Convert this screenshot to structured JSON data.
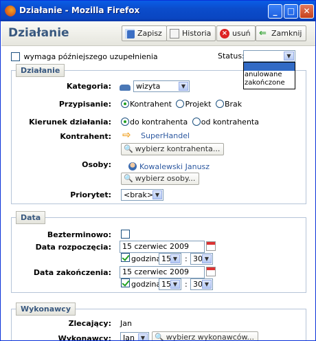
{
  "window": {
    "title": "Działanie - Mozilla Firefox",
    "min_label": "_",
    "max_label": "□",
    "close_label": "✕"
  },
  "header": {
    "page_title": "Działanie",
    "save_label": "Zapisz",
    "history_label": "Historia",
    "delete_label": "usuń",
    "close_label": "Zamknij"
  },
  "top": {
    "requires_completion_label": "wymaga późniejszego uzupełnienia",
    "status_label": "Status:",
    "status_value": "",
    "status_options": [
      "",
      "anulowane",
      "zakończone"
    ]
  },
  "dzialanie": {
    "legend": "Działanie",
    "kategoria_label": "Kategoria:",
    "kategoria_value": "wizyta",
    "przypisanie_label": "Przypisanie:",
    "przypisanie_options": [
      "Kontrahent",
      "Projekt",
      "Brak"
    ],
    "przypisanie_selected": "Kontrahent",
    "kierunek_label": "Kierunek działania:",
    "kierunek_options": [
      "do kontrahenta",
      "od kontrahenta"
    ],
    "kierunek_selected": "do kontrahenta",
    "kontrahent_label": "Kontrahent:",
    "kontrahent_value": "SuperHandel",
    "kontrahent_pick": "wybierz kontrahenta...",
    "osoby_label": "Osoby:",
    "osoby_value": "Kowalewski Janusz",
    "osoby_pick": "wybierz osoby...",
    "priorytet_label": "Priorytet:",
    "priorytet_value": "<brak>"
  },
  "data": {
    "legend": "Data",
    "bezterminowo_label": "Bezterminowo:",
    "start_label": "Data rozpoczęcia:",
    "start_date": "15 czerwiec 2009",
    "start_godzina": "godzina",
    "start_hour": "15",
    "start_min": "30",
    "end_label": "Data zakończenia:",
    "end_date": "15 czerwiec 2009",
    "end_godzina": "godzina",
    "end_hour": "15",
    "end_min": "30",
    "time_sep": ":"
  },
  "wykonawcy": {
    "legend": "Wykonawcy",
    "zlecajacy_label": "Zlecający:",
    "zlecajacy_value": "Jan",
    "wykonawcy_label": "Wykonawcy:",
    "wykonawcy_value": "Jan",
    "wykonawcy_pick": "wybierz wykonawców..."
  }
}
